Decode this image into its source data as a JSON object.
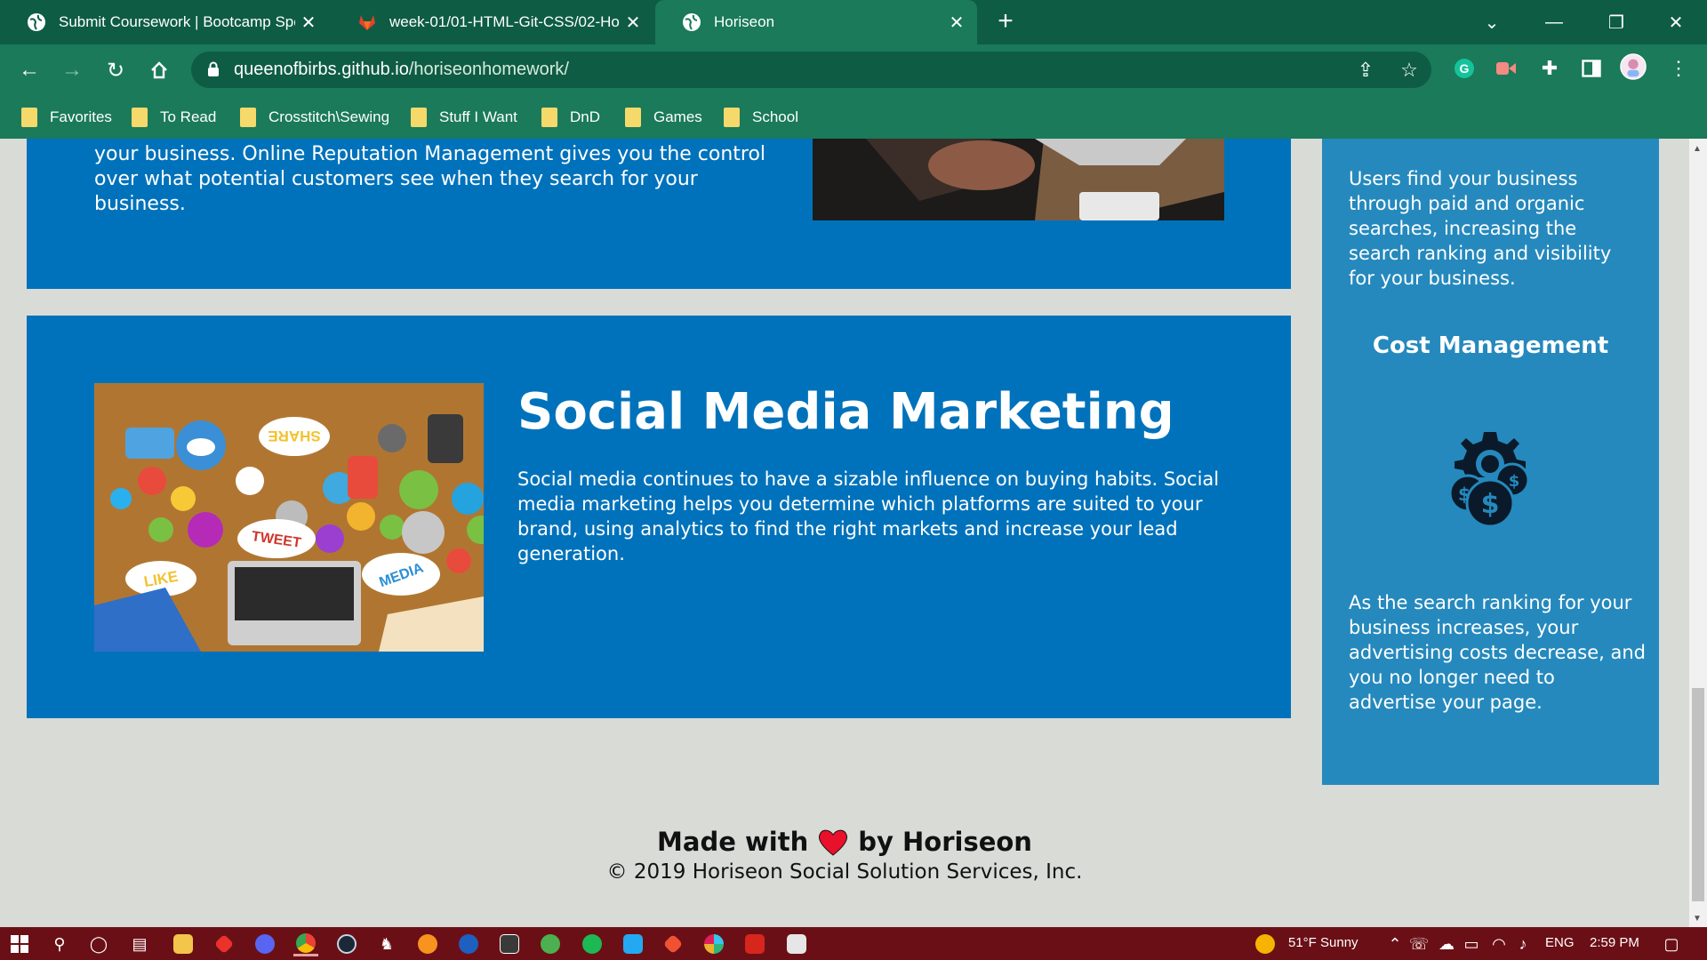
{
  "browser": {
    "tabs": [
      {
        "title": "Submit Coursework | Bootcamp Spo",
        "icon": "globe-icon",
        "active": false
      },
      {
        "title": "week-01/01-HTML-Git-CSS/02-Hom",
        "icon": "gitlab-icon",
        "active": false
      },
      {
        "title": "Horiseon",
        "icon": "globe-icon",
        "active": true
      }
    ],
    "url_host": "queenofbirbs.github.io",
    "url_path": "/horiseonhomework/",
    "bookmarks": [
      "Favorites",
      "To Read",
      "Crosstitch\\Sewing",
      "Stuff I Want",
      "DnD",
      "Games",
      "School"
    ]
  },
  "page": {
    "orm_text": "your business. Online Reputation Management gives you the control over what potential customers see when they search for your business.",
    "smm": {
      "title": "Social Media Marketing",
      "body": "Social media continues to have a sizable influence on buying habits. Social media marketing helps you determine which platforms are suited to your brand, using analytics to find the right markets and increase your lead generation.",
      "image_words": [
        "SHARE",
        "TWEET",
        "LIKE",
        "MEDIA"
      ]
    },
    "aside": {
      "lead_text": "Users find your business through paid and organic searches, increasing the search ranking and visibility for your business.",
      "cost_title": "Cost Management",
      "cost_text": "As the search ranking for your business increases, your advertising costs decrease, and you no longer need to advertise your page."
    },
    "footer": {
      "made_prefix": "Made with",
      "made_suffix": "by Horiseon",
      "copyright": "© 2019 Horiseon Social Solution Services, Inc."
    }
  },
  "taskbar": {
    "weather": "51°F  Sunny",
    "lang": "ENG",
    "time": "2:59 PM"
  },
  "colors": {
    "chrome_dark": "#0e5c44",
    "chrome_light": "#1a7a5a",
    "card_blue": "#0072bb",
    "aside_blue": "#2589bd",
    "page_bg": "#d9dbd7",
    "taskbar": "#6b0f16"
  }
}
